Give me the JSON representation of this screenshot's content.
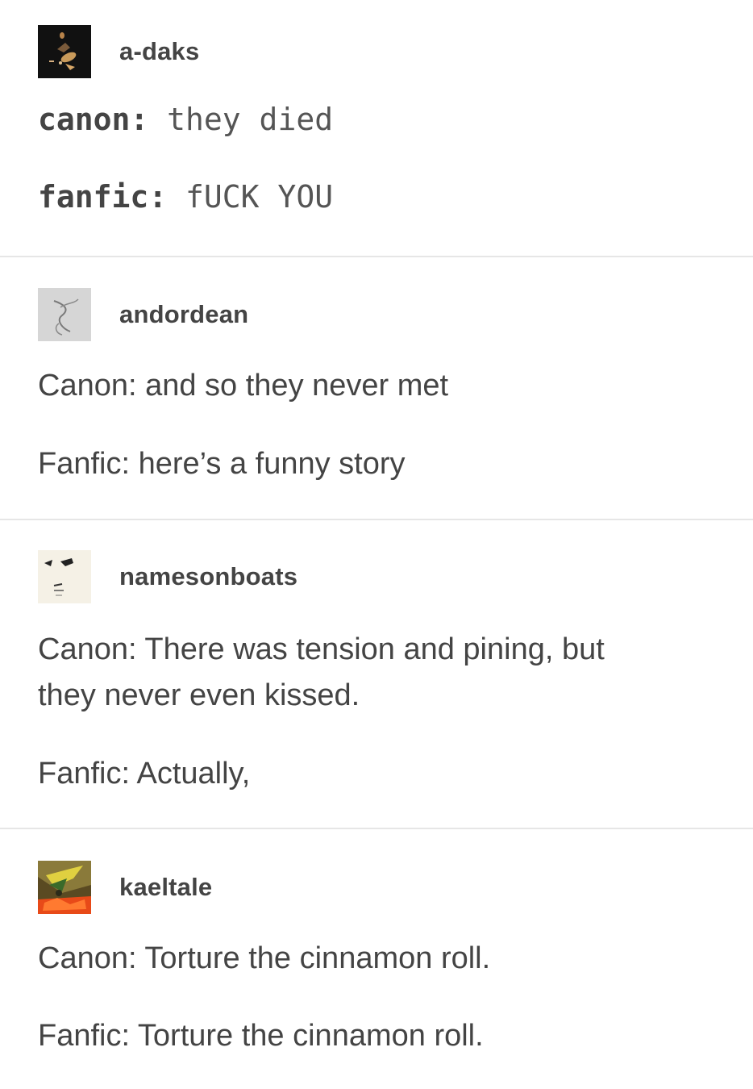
{
  "posts": [
    {
      "username": "a-daks",
      "avatar": "dark-figure-avatar",
      "lines": [
        {
          "label": "canon:",
          "text": "they died"
        },
        {
          "label": "fanfic:",
          "text": "fUCK YOU"
        }
      ]
    },
    {
      "username": "andordean",
      "avatar": "grey-sketch-avatar",
      "lines": [
        {
          "text": "Canon: and so they never met"
        },
        {
          "text": "Fanfic: here’s a funny story"
        }
      ]
    },
    {
      "username": "namesonboats",
      "avatar": "face-doodle-avatar",
      "lines": [
        {
          "text": "Canon: There was tension and pining, but"
        },
        {
          "text": "they never even kissed."
        },
        {
          "text": "Fanfic: Actually,"
        }
      ]
    },
    {
      "username": "kaeltale",
      "avatar": "colorful-art-avatar",
      "lines": [
        {
          "text": "Canon: Torture the cinnamon roll."
        },
        {
          "text": "Fanfic: Torture the cinnamon roll."
        }
      ]
    }
  ],
  "colors": {
    "text": "#444444",
    "divider": "#e6e6e6",
    "background": "#ffffff"
  }
}
